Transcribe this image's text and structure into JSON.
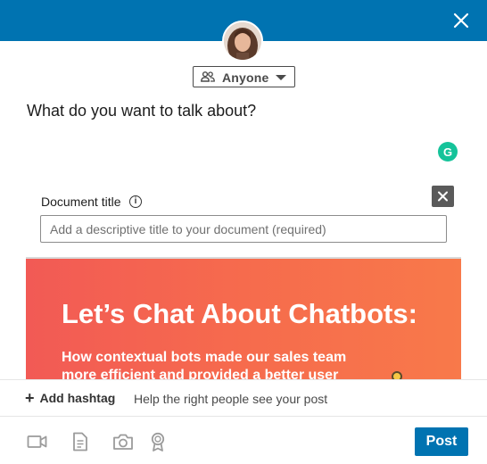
{
  "header": {
    "close_icon": "close-icon",
    "background_color": "#0073b1"
  },
  "composer": {
    "visibility_label": "Anyone",
    "visibility_icon": "people-icon",
    "prompt_text": "What do you want to talk about?",
    "grammarly_label": "G"
  },
  "document": {
    "title_label": "Document title",
    "info_icon_label": "i",
    "title_placeholder": "Add a descriptive title to your document (required)",
    "preview_heading": "Let’s Chat About Chatbots:",
    "preview_subtitle": "How contextual bots made our sales team more efficient and provided a better user experience",
    "preview_colors": [
      "#f25a55",
      "#f8794a"
    ]
  },
  "hashtag": {
    "add_label": "Add hashtag",
    "hint": "Help the right people see your post"
  },
  "toolbar": {
    "icons": [
      "video-icon",
      "document-icon",
      "camera-icon",
      "award-icon"
    ],
    "post_label": "Post",
    "post_color": "#0073b1"
  }
}
